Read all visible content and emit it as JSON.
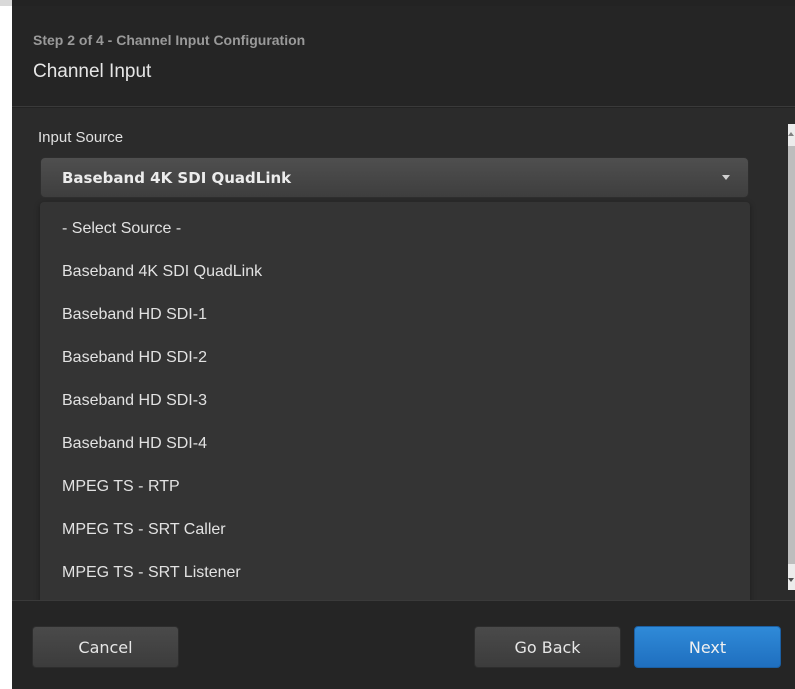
{
  "header": {
    "step_text": "Step 2 of 4 - Channel Input Configuration",
    "title": "Channel Input"
  },
  "input_source": {
    "label": "Input Source",
    "selected_value": "Baseband 4K SDI QuadLink",
    "options": [
      "- Select Source -",
      "Baseband 4K SDI QuadLink",
      "Baseband HD SDI-1",
      "Baseband HD SDI-2",
      "Baseband HD SDI-3",
      "Baseband HD SDI-4",
      "MPEG TS - RTP",
      "MPEG TS - SRT Caller",
      "MPEG TS - SRT Listener"
    ]
  },
  "footer": {
    "cancel_label": "Cancel",
    "back_label": "Go Back",
    "next_label": "Next"
  },
  "colors": {
    "dialog_bg": "#232323",
    "body_bg": "#2b2b2b",
    "dropdown_bg": "#343434",
    "primary_button": "#2a80d0"
  }
}
